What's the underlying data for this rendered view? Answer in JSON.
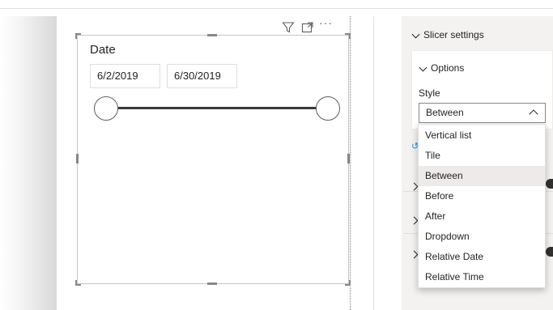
{
  "slicer": {
    "title": "Date",
    "start_date": "6/2/2019",
    "end_date": "6/30/2019",
    "range_fraction": [
      0,
      1
    ],
    "header_icons": [
      "filter-icon",
      "focus-mode-icon",
      "more-options-icon"
    ],
    "more_label": "···"
  },
  "format_pane": {
    "section_title": "Slicer settings",
    "options_title": "Options",
    "style_label": "Style",
    "style_value": "Between",
    "collapsed_rows": [
      "chevron-right-icon",
      "chevron-right-icon",
      "chevron-right-icon"
    ]
  },
  "style_dropdown": {
    "options": [
      "Vertical list",
      "Tile",
      "Between",
      "Before",
      "After",
      "Dropdown",
      "Relative Date",
      "Relative Time"
    ],
    "selected": "Between"
  },
  "colors": {
    "accent": "#118dff",
    "selected_bg": "#edebe9",
    "pane_bg": "#f3f2f1"
  }
}
